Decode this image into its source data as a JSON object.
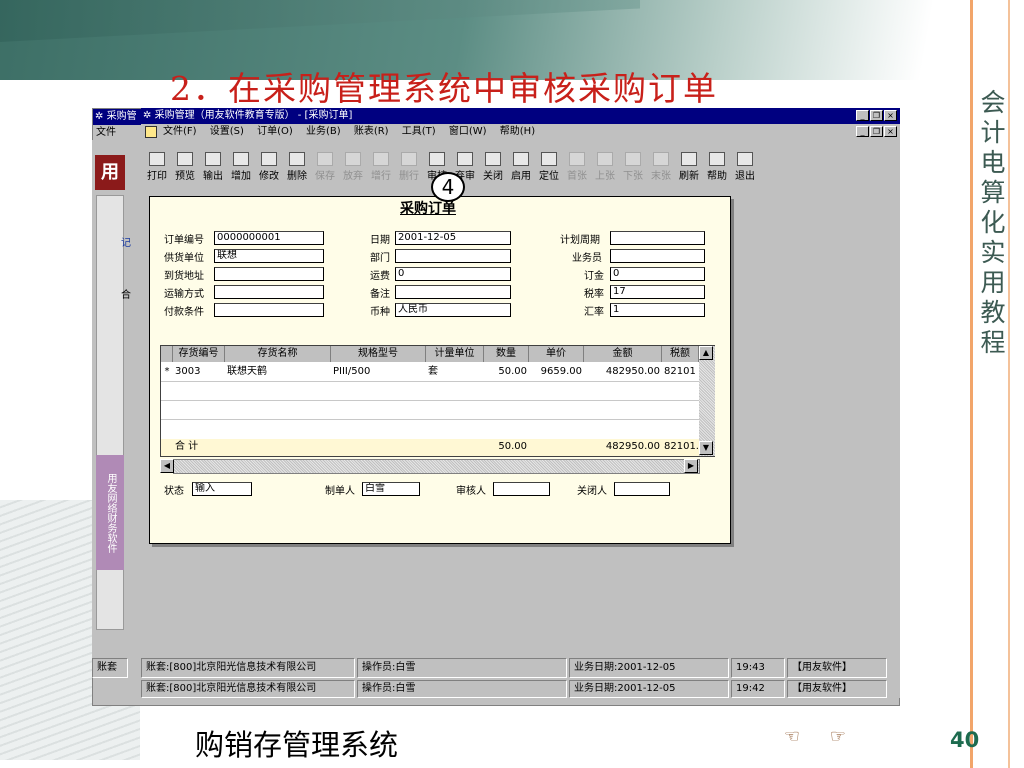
{
  "slide": {
    "title": "2．在采购管理系统中审核采购订单",
    "side_title": "会计电算化实用教程",
    "footer": "购销存管理系统",
    "page": "40",
    "callout": "4",
    "nav": {
      "prev": "☜",
      "next": "☞"
    }
  },
  "outer_window": {
    "title": "采购管",
    "menu": [
      "文件"
    ],
    "left_logo": "用",
    "left_label": "用友网络财务软件",
    "left_labels": [
      "记",
      "合"
    ]
  },
  "inner_window": {
    "title": "采购管理（用友软件教育专版） - [采购订单]",
    "menu": [
      "文件(F)",
      "设置(S)",
      "订单(O)",
      "业务(B)",
      "账表(R)",
      "工具(T)",
      "窗口(W)",
      "帮助(H)"
    ],
    "toolbar": [
      {
        "label": "打印",
        "icon": "printer-icon",
        "enabled": true
      },
      {
        "label": "预览",
        "icon": "preview-icon",
        "enabled": true
      },
      {
        "label": "输出",
        "icon": "export-icon",
        "enabled": true
      },
      {
        "label": "增加",
        "icon": "add-icon",
        "enabled": true
      },
      {
        "label": "修改",
        "icon": "edit-icon",
        "enabled": true
      },
      {
        "label": "删除",
        "icon": "delete-icon",
        "enabled": true
      },
      {
        "label": "保存",
        "icon": "save-icon",
        "enabled": false
      },
      {
        "label": "放弃",
        "icon": "discard-icon",
        "enabled": false
      },
      {
        "label": "增行",
        "icon": "add-row-icon",
        "enabled": false
      },
      {
        "label": "删行",
        "icon": "delete-row-icon",
        "enabled": false
      },
      {
        "label": "审核",
        "icon": "approve-icon",
        "enabled": true
      },
      {
        "label": "弃审",
        "icon": "unapprove-icon",
        "enabled": true
      },
      {
        "label": "关闭",
        "icon": "close-doc-icon",
        "enabled": true
      },
      {
        "label": "启用",
        "icon": "enable-icon",
        "enabled": true
      },
      {
        "label": "定位",
        "icon": "locate-icon",
        "enabled": true
      },
      {
        "label": "首张",
        "icon": "first-icon",
        "enabled": false
      },
      {
        "label": "上张",
        "icon": "prev-icon",
        "enabled": false
      },
      {
        "label": "下张",
        "icon": "next-icon",
        "enabled": false
      },
      {
        "label": "末张",
        "icon": "last-icon",
        "enabled": false
      },
      {
        "label": "刷新",
        "icon": "refresh-icon",
        "enabled": true
      },
      {
        "label": "帮助",
        "icon": "help-icon",
        "enabled": true
      },
      {
        "label": "退出",
        "icon": "exit-icon",
        "enabled": true
      }
    ]
  },
  "form": {
    "title": "采购订单",
    "fields": {
      "order_no": {
        "label": "订单编号",
        "value": "0000000001"
      },
      "supplier": {
        "label": "供货单位",
        "value": "联想"
      },
      "ship_to": {
        "label": "到货地址",
        "value": ""
      },
      "transport": {
        "label": "运输方式",
        "value": ""
      },
      "payment": {
        "label": "付款条件",
        "value": ""
      },
      "date": {
        "label": "日期",
        "value": "2001-12-05"
      },
      "dept": {
        "label": "部门",
        "value": ""
      },
      "freight": {
        "label": "运费",
        "value": "0"
      },
      "remark": {
        "label": "备注",
        "value": ""
      },
      "currency": {
        "label": "币种",
        "value": "人民币"
      },
      "plan_period": {
        "label": "计划周期",
        "value": ""
      },
      "salesman": {
        "label": "业务员",
        "value": ""
      },
      "deposit": {
        "label": "订金",
        "value": "0"
      },
      "tax_rate": {
        "label": "税率",
        "value": "17"
      },
      "exchange_rate": {
        "label": "汇率",
        "value": "1"
      }
    },
    "grid": {
      "columns": [
        "存货编号",
        "存货名称",
        "规格型号",
        "计量单位",
        "数量",
        "单价",
        "金额",
        "税额"
      ],
      "rows": [
        {
          "marker": "*",
          "cells": [
            "3003",
            "联想天鹤",
            "PIII/500",
            "套",
            "50.00",
            "9659.00",
            "482950.00",
            "82101"
          ]
        }
      ],
      "total": {
        "label": "合  计",
        "qty": "50.00",
        "amount": "482950.00",
        "tax": "82101."
      }
    },
    "footer": {
      "status": {
        "label": "状态",
        "value": "输入"
      },
      "maker": {
        "label": "制单人",
        "value": "白雪"
      },
      "auditor": {
        "label": "审核人",
        "value": ""
      },
      "closer": {
        "label": "关闭人",
        "value": ""
      }
    }
  },
  "status_bar_inner": {
    "account": "账套:[800]北京阳光信息技术有限公司",
    "operator": "操作员:白雪",
    "biz_date": "业务日期:2001-12-05",
    "time": "19:43",
    "brand": "【用友软件】"
  },
  "status_bar_outer": {
    "account_short": "账套",
    "account": "账套:[800]北京阳光信息技术有限公司",
    "operator": "操作员:白雪",
    "biz_date": "业务日期:2001-12-05",
    "time": "19:42",
    "brand": "【用友软件】"
  },
  "colors": {
    "title_red": "#c8201a",
    "titlebar": "#000080",
    "form_bg": "#fffde8",
    "page_num": "#1d6b4f"
  }
}
